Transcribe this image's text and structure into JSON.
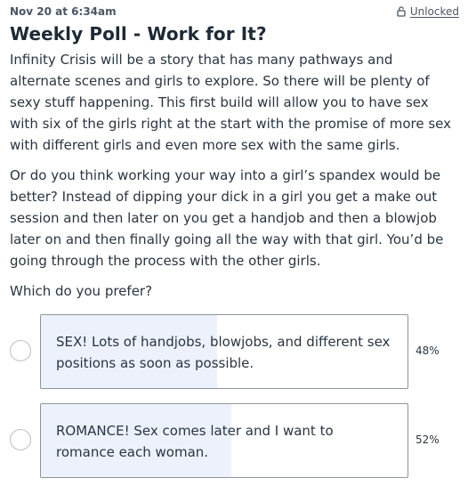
{
  "post": {
    "date": "Nov 20 at 6:34am",
    "unlocked_label": "Unlocked",
    "unlocked_icon": "open-lock-icon",
    "title": "Weekly Poll - Work for It?",
    "paragraphs": [
      "Infinity Crisis will be a story that has many pathways and alternate scenes and girls to explore. So there will be plenty of sexy stuff happening. This first build will allow you to have sex with six of the girls right at the start with the promise of more sex with different girls and even more sex with the same girls.",
      "Or do you think working your way into a girl’s spandex would be better? Instead of dipping your dick in a girl you get a make out session and then later on you get a handjob and then a blowjob later on and then finally going all the way with that girl. You’d be going through the process with the other girls.",
      "Which do you prefer?"
    ]
  },
  "poll": {
    "options": [
      {
        "label": "SEX! Lots of handjobs, blowjobs, and different sex positions as soon as possible.",
        "percent_label": "48%",
        "percent": 48
      },
      {
        "label": "ROMANCE! Sex comes later and I want to romance each woman.",
        "percent_label": "52%",
        "percent": 52
      }
    ],
    "fill_color": "#edf1fc"
  }
}
